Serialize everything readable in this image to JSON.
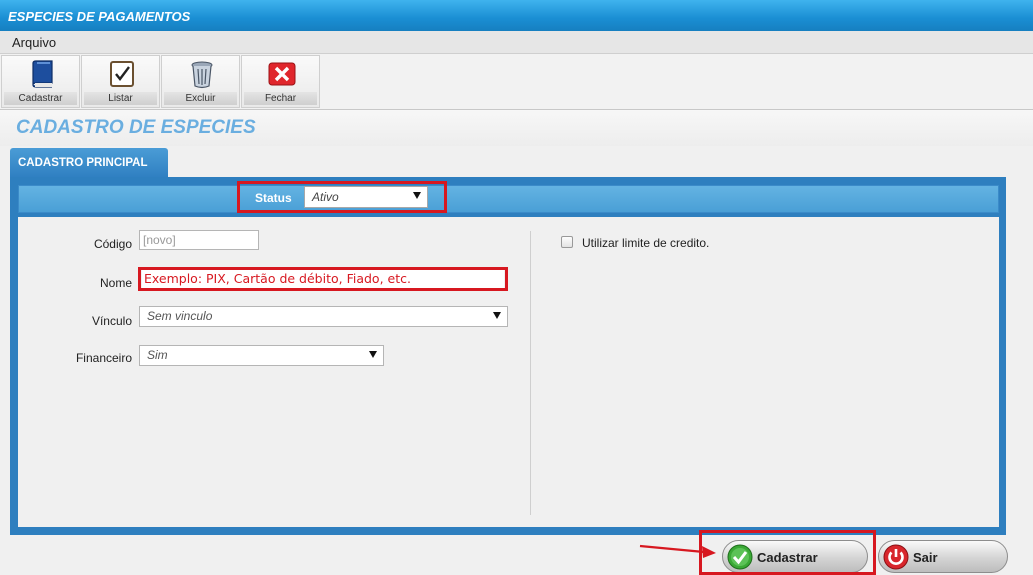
{
  "window": {
    "title": "ESPECIES DE PAGAMENTOS"
  },
  "menu": {
    "items": [
      "Arquivo"
    ]
  },
  "toolbar": {
    "buttons": [
      {
        "label": "Cadastrar",
        "icon": "book-icon"
      },
      {
        "label": "Listar",
        "icon": "checklist-icon"
      },
      {
        "label": "Excluir",
        "icon": "trash-icon"
      },
      {
        "label": "Fechar",
        "icon": "close-icon"
      }
    ]
  },
  "section": {
    "title": "CADASTRO DE ESPECIES"
  },
  "tab": {
    "label": "CADASTRO PRINCIPAL"
  },
  "status": {
    "label": "Status",
    "value": "Ativo"
  },
  "form": {
    "codigo": {
      "label": "Código",
      "placeholder": "[novo]"
    },
    "nome": {
      "label": "Nome",
      "placeholder": "Exemplo: PIX, Cartão de débito, Fiado, etc."
    },
    "vinculo": {
      "label": "Vínculo",
      "value": "Sem vinculo"
    },
    "financeiro": {
      "label": "Financeiro",
      "value": "Sim"
    },
    "limite": {
      "label": "Utilizar limite de credito.",
      "checked": false
    }
  },
  "actions": {
    "save_label": "Cadastrar",
    "exit_label": "Sair"
  },
  "colors": {
    "highlight": "#d71820",
    "accent": "#2e7fbf"
  }
}
